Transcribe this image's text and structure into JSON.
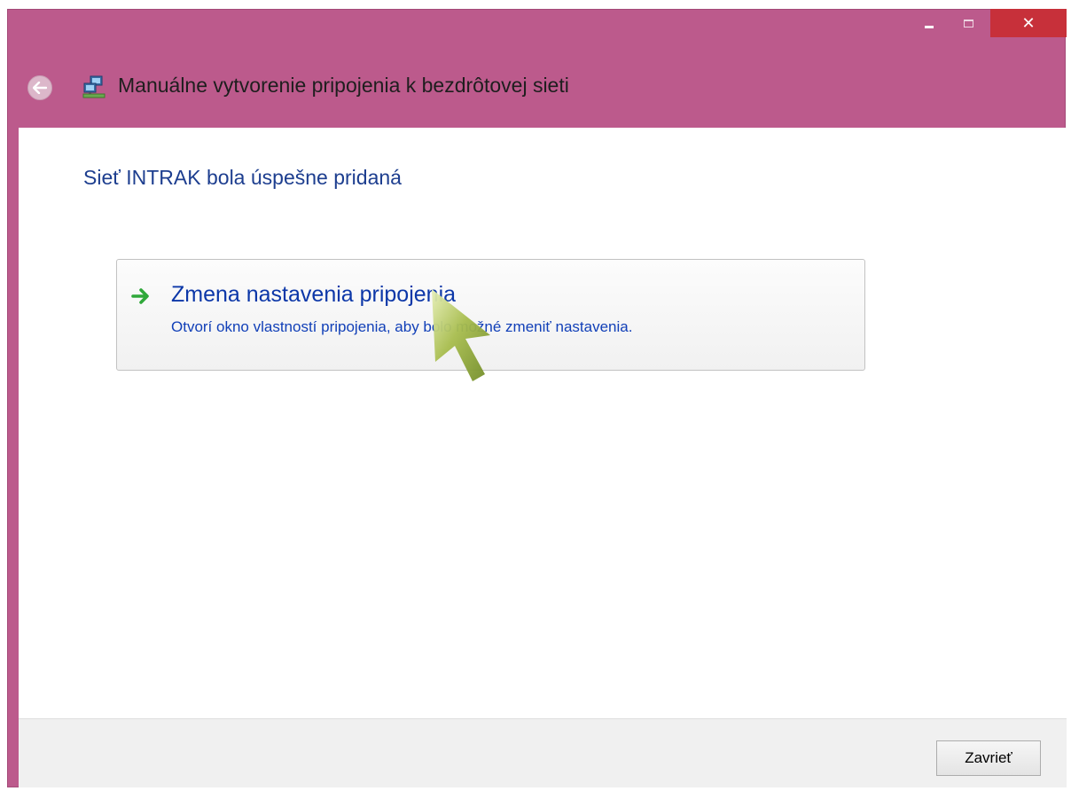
{
  "window": {
    "title": "Manuálne vytvorenie pripojenia k bezdrôtovej sieti",
    "controls": {
      "minimize_icon": "minimize-icon",
      "maximize_icon": "maximize-icon",
      "close_icon": "close-icon",
      "close_glyph": "✕"
    },
    "back_icon": "back-arrow-icon",
    "network_icon": "network-connection-icon"
  },
  "main": {
    "heading": "Sieť INTRAK bola úspešne pridaná",
    "command_link": {
      "title": "Zmena nastavenia pripojenia",
      "description": "Otvorí okno vlastností pripojenia, aby bolo možné zmeniť nastavenia.",
      "icon": "green-arrow-icon"
    }
  },
  "footer": {
    "close_label": "Zavrieť"
  },
  "colors": {
    "titlebar": "#bc5a8c",
    "close_button": "#c7303a",
    "heading": "#1d3e8f",
    "link": "#0c37a8",
    "cursor": "#8aa23a"
  }
}
